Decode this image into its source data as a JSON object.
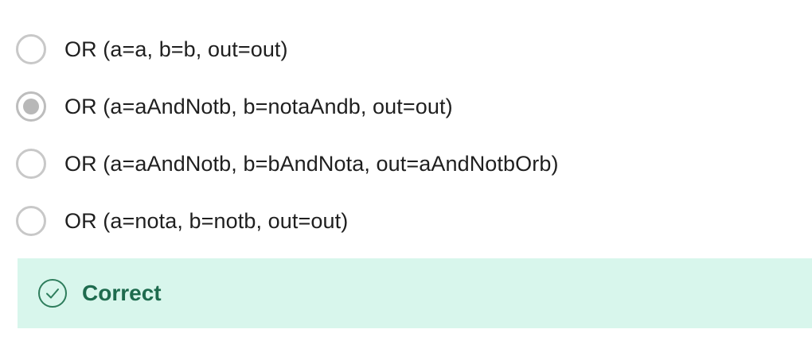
{
  "options": [
    {
      "label": "OR (a=a, b=b, out=out)",
      "selected": false
    },
    {
      "label": "OR (a=aAndNotb, b=notaAndb, out=out)",
      "selected": true
    },
    {
      "label": "OR (a=aAndNotb, b=bAndNota, out=aAndNotbOrb)",
      "selected": false
    },
    {
      "label": "OR (a=nota, b=notb, out=out)",
      "selected": false
    }
  ],
  "feedback": {
    "label": "Correct",
    "icon": "check-circle-icon",
    "background_color": "#d8f6ec",
    "text_color": "#1e6b4e"
  }
}
